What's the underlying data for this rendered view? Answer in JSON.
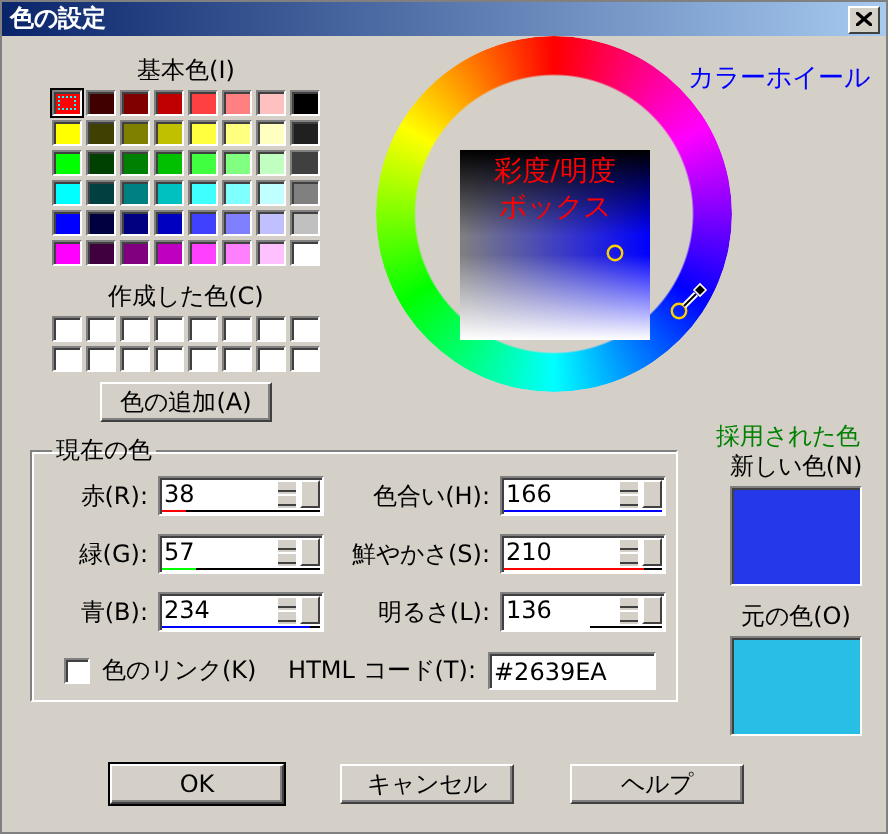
{
  "window": {
    "title": "色の設定"
  },
  "basic_colors": {
    "title": "基本色(I)",
    "swatches": [
      {
        "color": "#ff0000",
        "selected": true
      },
      {
        "color": "#400000",
        "selected": false
      },
      {
        "color": "#800000",
        "selected": false
      },
      {
        "color": "#c00000",
        "selected": false
      },
      {
        "color": "#ff4040",
        "selected": false
      },
      {
        "color": "#ff8080",
        "selected": false
      },
      {
        "color": "#ffc0c0",
        "selected": false
      },
      {
        "color": "#000000",
        "selected": false
      },
      {
        "color": "#ffff00",
        "selected": false
      },
      {
        "color": "#404000",
        "selected": false
      },
      {
        "color": "#808000",
        "selected": false
      },
      {
        "color": "#c0c000",
        "selected": false
      },
      {
        "color": "#ffff40",
        "selected": false
      },
      {
        "color": "#ffff80",
        "selected": false
      },
      {
        "color": "#ffffc0",
        "selected": false
      },
      {
        "color": "#202020",
        "selected": false
      },
      {
        "color": "#00ff00",
        "selected": false
      },
      {
        "color": "#004000",
        "selected": false
      },
      {
        "color": "#008000",
        "selected": false
      },
      {
        "color": "#00c000",
        "selected": false
      },
      {
        "color": "#40ff40",
        "selected": false
      },
      {
        "color": "#80ff80",
        "selected": false
      },
      {
        "color": "#c0ffc0",
        "selected": false
      },
      {
        "color": "#404040",
        "selected": false
      },
      {
        "color": "#00ffff",
        "selected": false
      },
      {
        "color": "#004040",
        "selected": false
      },
      {
        "color": "#008080",
        "selected": false
      },
      {
        "color": "#00c0c0",
        "selected": false
      },
      {
        "color": "#40ffff",
        "selected": false
      },
      {
        "color": "#80ffff",
        "selected": false
      },
      {
        "color": "#c0ffff",
        "selected": false
      },
      {
        "color": "#808080",
        "selected": false
      },
      {
        "color": "#0000ff",
        "selected": false
      },
      {
        "color": "#000040",
        "selected": false
      },
      {
        "color": "#000080",
        "selected": false
      },
      {
        "color": "#0000c0",
        "selected": false
      },
      {
        "color": "#4040ff",
        "selected": false
      },
      {
        "color": "#8080ff",
        "selected": false
      },
      {
        "color": "#c0c0ff",
        "selected": false
      },
      {
        "color": "#c0c0c0",
        "selected": false
      },
      {
        "color": "#ff00ff",
        "selected": false
      },
      {
        "color": "#400040",
        "selected": false
      },
      {
        "color": "#800080",
        "selected": false
      },
      {
        "color": "#c000c0",
        "selected": false
      },
      {
        "color": "#ff40ff",
        "selected": false
      },
      {
        "color": "#ff80ff",
        "selected": false
      },
      {
        "color": "#ffc0ff",
        "selected": false
      },
      {
        "color": "#ffffff",
        "selected": false
      }
    ]
  },
  "custom_colors": {
    "title": "作成した色(C)",
    "swatches": [
      {
        "color": "#ffffff"
      },
      {
        "color": "#ffffff"
      },
      {
        "color": "#ffffff"
      },
      {
        "color": "#ffffff"
      },
      {
        "color": "#ffffff"
      },
      {
        "color": "#ffffff"
      },
      {
        "color": "#ffffff"
      },
      {
        "color": "#ffffff"
      },
      {
        "color": "#ffffff"
      },
      {
        "color": "#ffffff"
      },
      {
        "color": "#ffffff"
      },
      {
        "color": "#ffffff"
      },
      {
        "color": "#ffffff"
      },
      {
        "color": "#ffffff"
      },
      {
        "color": "#ffffff"
      },
      {
        "color": "#ffffff"
      }
    ]
  },
  "add_button": "色の追加(A)",
  "wheel": {
    "title": "カラーホイール",
    "box_label": [
      "彩度/明度",
      "ボックス"
    ]
  },
  "current": {
    "title": "現在の色",
    "rgb": [
      {
        "label": "赤(R):",
        "value": "38",
        "level": 0.15,
        "color": "#ff0000"
      },
      {
        "label": "緑(G):",
        "value": "57",
        "level": 0.22,
        "color": "#00ff00"
      },
      {
        "label": "青(B):",
        "value": "234",
        "level": 0.94,
        "color": "#0000ff"
      }
    ],
    "hsl": [
      {
        "label": "色合い(H):",
        "value": "166",
        "level": 1,
        "color": "#0000ff"
      },
      {
        "label": "鮮やかさ(S):",
        "value": "210",
        "level": 0.88,
        "color": "#ff0000"
      },
      {
        "label": "明るさ(L):",
        "value": "136",
        "level": 0.54,
        "color": "#ffffff"
      }
    ],
    "link": {
      "label": "色のリンク(K)",
      "checked": false
    },
    "html": {
      "label": "HTML コード(T):",
      "value": "#2639EA"
    }
  },
  "adopted": {
    "title": "採用された色",
    "new": {
      "label": "新しい色(N)",
      "color": "#2639ea"
    },
    "old": {
      "label": "元の色(O)",
      "color": "#28bee6"
    }
  },
  "buttons": [
    {
      "label": "OK",
      "default": true
    },
    {
      "label": "キャンセル",
      "default": false
    },
    {
      "label": "ヘルプ",
      "default": false
    }
  ]
}
